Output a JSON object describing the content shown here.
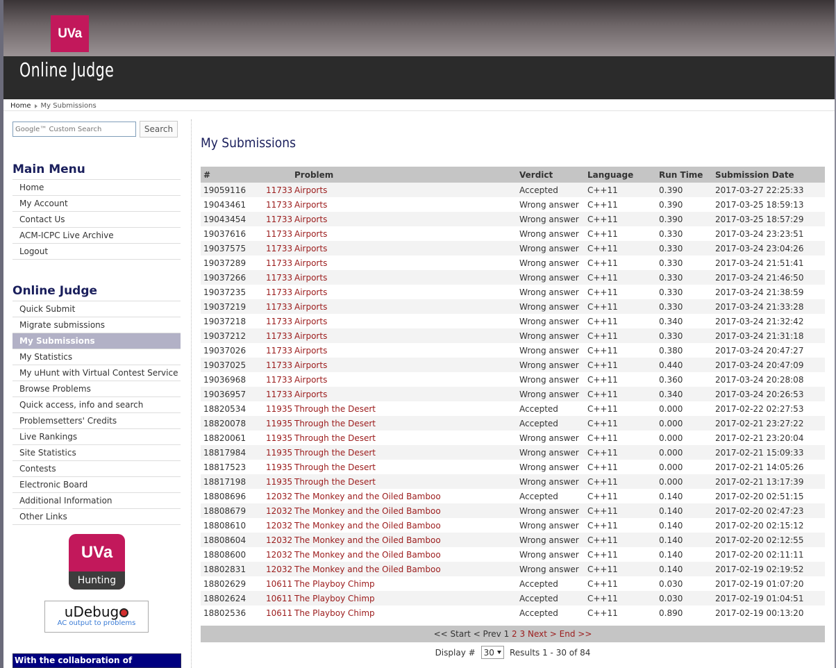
{
  "header": {
    "logo_text": "UVa",
    "site_title": "Online Judge"
  },
  "breadcrumb": {
    "home": "Home",
    "current": "My Submissions"
  },
  "search": {
    "placeholder": "Google™ Custom Search",
    "button_label": "Search"
  },
  "main_menu": {
    "title": "Main Menu",
    "items": [
      "Home",
      "My Account",
      "Contact Us",
      "ACM-ICPC Live Archive",
      "Logout"
    ]
  },
  "judge_menu": {
    "title": "Online Judge",
    "active_index": 2,
    "items": [
      "Quick Submit",
      "Migrate submissions",
      "My Submissions",
      "My Statistics",
      "My uHunt with Virtual Contest Service",
      "Browse Problems",
      "Quick access, info and search",
      "Problemsetters' Credits",
      "Live Rankings",
      "Site Statistics",
      "Contests",
      "Electronic Board",
      "Additional Information",
      "Other Links"
    ]
  },
  "hunting_badge": {
    "top": "UVa",
    "bottom": "Hunting"
  },
  "udebug": {
    "title_prefix": "uDebug",
    "subtitle": "AC output to problems"
  },
  "collab_text": "With the collaboration of",
  "page": {
    "title": "My Submissions"
  },
  "table": {
    "headers": [
      "#",
      "Problem",
      "Verdict",
      "Language",
      "Run Time",
      "Submission Date"
    ],
    "rows": [
      [
        "19059116",
        "11733",
        "Airports",
        "Accepted",
        "C++11",
        "0.390",
        "2017-03-27 22:25:33"
      ],
      [
        "19043461",
        "11733",
        "Airports",
        "Wrong answer",
        "C++11",
        "0.390",
        "2017-03-25 18:59:13"
      ],
      [
        "19043454",
        "11733",
        "Airports",
        "Wrong answer",
        "C++11",
        "0.390",
        "2017-03-25 18:57:29"
      ],
      [
        "19037616",
        "11733",
        "Airports",
        "Wrong answer",
        "C++11",
        "0.330",
        "2017-03-24 23:23:51"
      ],
      [
        "19037575",
        "11733",
        "Airports",
        "Wrong answer",
        "C++11",
        "0.330",
        "2017-03-24 23:04:26"
      ],
      [
        "19037289",
        "11733",
        "Airports",
        "Wrong answer",
        "C++11",
        "0.330",
        "2017-03-24 21:51:41"
      ],
      [
        "19037266",
        "11733",
        "Airports",
        "Wrong answer",
        "C++11",
        "0.330",
        "2017-03-24 21:46:50"
      ],
      [
        "19037235",
        "11733",
        "Airports",
        "Wrong answer",
        "C++11",
        "0.330",
        "2017-03-24 21:38:59"
      ],
      [
        "19037219",
        "11733",
        "Airports",
        "Wrong answer",
        "C++11",
        "0.330",
        "2017-03-24 21:33:28"
      ],
      [
        "19037218",
        "11733",
        "Airports",
        "Wrong answer",
        "C++11",
        "0.340",
        "2017-03-24 21:32:42"
      ],
      [
        "19037212",
        "11733",
        "Airports",
        "Wrong answer",
        "C++11",
        "0.330",
        "2017-03-24 21:31:18"
      ],
      [
        "19037026",
        "11733",
        "Airports",
        "Wrong answer",
        "C++11",
        "0.380",
        "2017-03-24 20:47:27"
      ],
      [
        "19037025",
        "11733",
        "Airports",
        "Wrong answer",
        "C++11",
        "0.440",
        "2017-03-24 20:47:09"
      ],
      [
        "19036968",
        "11733",
        "Airports",
        "Wrong answer",
        "C++11",
        "0.360",
        "2017-03-24 20:28:08"
      ],
      [
        "19036957",
        "11733",
        "Airports",
        "Wrong answer",
        "C++11",
        "0.340",
        "2017-03-24 20:26:53"
      ],
      [
        "18820534",
        "11935",
        "Through the Desert",
        "Accepted",
        "C++11",
        "0.000",
        "2017-02-22 02:27:53"
      ],
      [
        "18820078",
        "11935",
        "Through the Desert",
        "Accepted",
        "C++11",
        "0.000",
        "2017-02-21 23:27:22"
      ],
      [
        "18820061",
        "11935",
        "Through the Desert",
        "Wrong answer",
        "C++11",
        "0.000",
        "2017-02-21 23:20:04"
      ],
      [
        "18817984",
        "11935",
        "Through the Desert",
        "Wrong answer",
        "C++11",
        "0.000",
        "2017-02-21 15:09:33"
      ],
      [
        "18817523",
        "11935",
        "Through the Desert",
        "Wrong answer",
        "C++11",
        "0.000",
        "2017-02-21 14:05:26"
      ],
      [
        "18817198",
        "11935",
        "Through the Desert",
        "Wrong answer",
        "C++11",
        "0.000",
        "2017-02-21 13:17:39"
      ],
      [
        "18808696",
        "12032",
        "The Monkey and the Oiled Bamboo",
        "Accepted",
        "C++11",
        "0.140",
        "2017-02-20 02:51:15"
      ],
      [
        "18808679",
        "12032",
        "The Monkey and the Oiled Bamboo",
        "Wrong answer",
        "C++11",
        "0.140",
        "2017-02-20 02:47:23"
      ],
      [
        "18808610",
        "12032",
        "The Monkey and the Oiled Bamboo",
        "Wrong answer",
        "C++11",
        "0.140",
        "2017-02-20 02:15:12"
      ],
      [
        "18808604",
        "12032",
        "The Monkey and the Oiled Bamboo",
        "Wrong answer",
        "C++11",
        "0.140",
        "2017-02-20 02:12:55"
      ],
      [
        "18808600",
        "12032",
        "The Monkey and the Oiled Bamboo",
        "Wrong answer",
        "C++11",
        "0.140",
        "2017-02-20 02:11:11"
      ],
      [
        "18802831",
        "12032",
        "The Monkey and the Oiled Bamboo",
        "Wrong answer",
        "C++11",
        "0.140",
        "2017-02-19 02:19:52"
      ],
      [
        "18802629",
        "10611",
        "The Playboy Chimp",
        "Accepted",
        "C++11",
        "0.030",
        "2017-02-19 01:07:20"
      ],
      [
        "18802624",
        "10611",
        "The Playboy Chimp",
        "Accepted",
        "C++11",
        "0.030",
        "2017-02-19 01:04:51"
      ],
      [
        "18802536",
        "10611",
        "The Playboy Chimp",
        "Accepted",
        "C++11",
        "0.890",
        "2017-02-19 00:13:20"
      ]
    ]
  },
  "pager": {
    "start": "<< Start",
    "prev": "< Prev",
    "current_page": "1",
    "pages": [
      "2",
      "3"
    ],
    "next": "Next >",
    "end": "End >>"
  },
  "display": {
    "label": "Display #",
    "selected": "30",
    "results": "Results 1 - 30 of 84"
  },
  "colors": {
    "brand": "#c2185b",
    "link": "#9b1b1b",
    "heading": "#1a1f5c",
    "active_menu": "#b2b1c6",
    "table_header": "#c5c5c5"
  }
}
